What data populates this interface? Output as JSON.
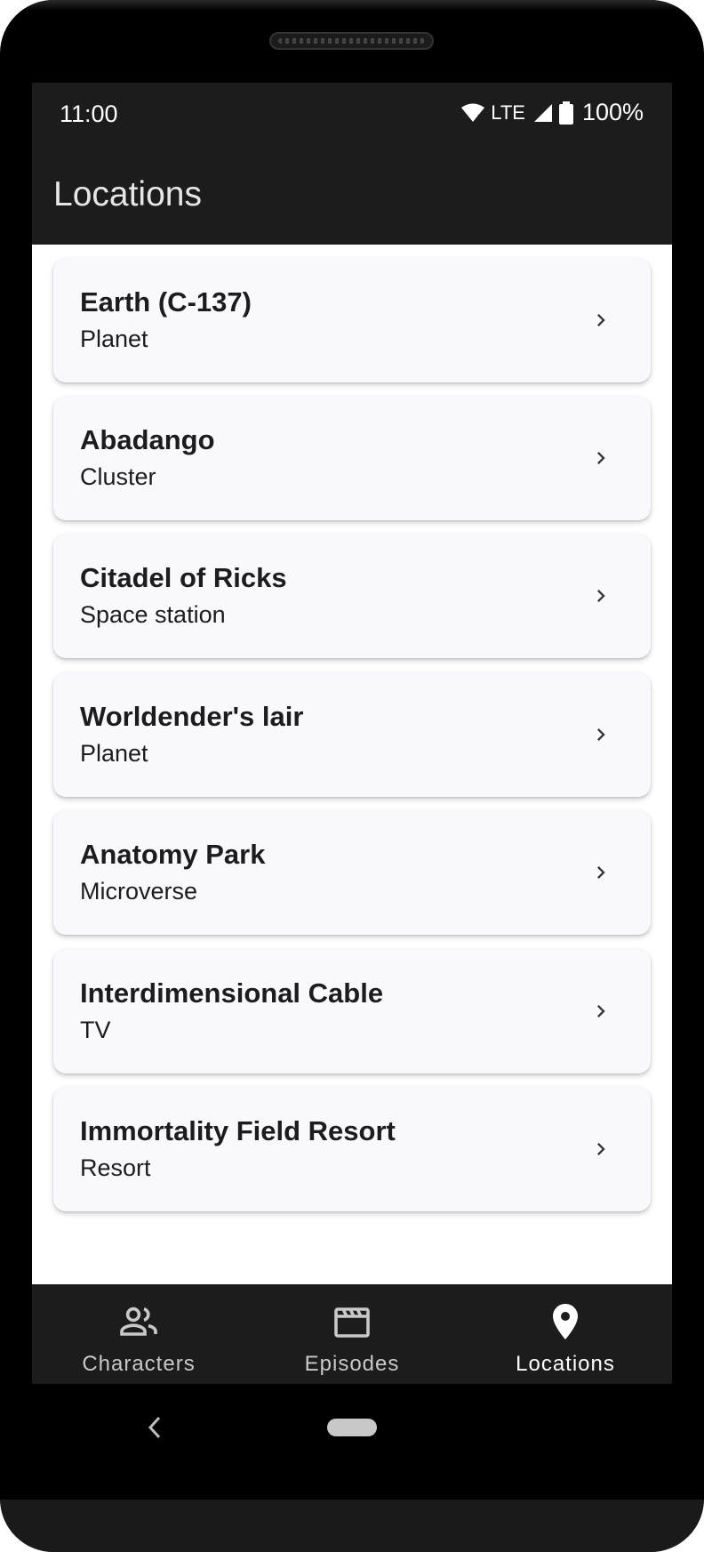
{
  "status_bar": {
    "time": "11:00",
    "network": "LTE",
    "battery": "100%"
  },
  "app_bar": {
    "title": "Locations"
  },
  "locations": [
    {
      "name": "Earth (C-137)",
      "type": "Planet"
    },
    {
      "name": "Abadango",
      "type": "Cluster"
    },
    {
      "name": "Citadel of Ricks",
      "type": "Space station"
    },
    {
      "name": "Worldender's lair",
      "type": "Planet"
    },
    {
      "name": "Anatomy Park",
      "type": "Microverse"
    },
    {
      "name": "Interdimensional Cable",
      "type": "TV"
    },
    {
      "name": "Immortality Field Resort",
      "type": "Resort"
    }
  ],
  "bottom_nav": {
    "items": [
      {
        "label": "Characters",
        "icon": "people-icon",
        "active": false
      },
      {
        "label": "Episodes",
        "icon": "clapperboard-icon",
        "active": false
      },
      {
        "label": "Locations",
        "icon": "location-pin-icon",
        "active": true
      }
    ]
  },
  "colors": {
    "bar_background": "#1c1c1c",
    "card_background": "#f9f9fd",
    "text_primary": "#1c1c1c",
    "nav_inactive": "#c9c9c9",
    "nav_active": "#ffffff"
  }
}
